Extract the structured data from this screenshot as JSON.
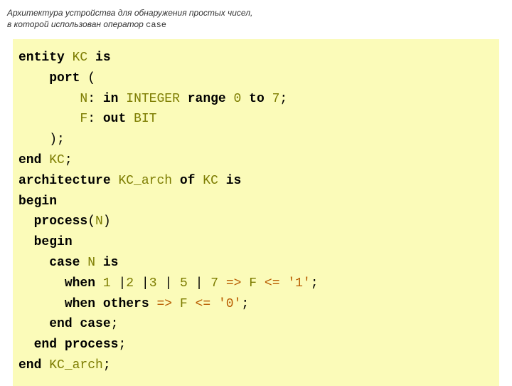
{
  "caption": {
    "line1": "Архитектура устройства для обнаружения простых чисел,",
    "line2_prefix": "в которой использован оператор ",
    "line2_mono": "case"
  },
  "code": {
    "entity_kw": "entity",
    "entity_name": "KC",
    "is_kw": "is",
    "port_kw": "port",
    "open_paren": "(",
    "n_id": "N",
    "colon": ":",
    "in_kw": "in",
    "integer_ty": "INTEGER",
    "range_kw": "range",
    "zero": "0",
    "to_kw": "to",
    "seven": "7",
    "semi": ";",
    "f_id": "F",
    "out_kw": "out",
    "bit_ty": "BIT",
    "close_paren": ")",
    "end_kw": "end",
    "arch_kw": "architecture",
    "arch_name": "KC_arch",
    "of_kw": "of",
    "begin_kw": "begin",
    "process_kw": "process",
    "case_kw": "case",
    "when_kw": "when",
    "others_kw": "others",
    "end_case": "end case",
    "end_process": "end process",
    "vals_1": "1",
    "vals_2": "2",
    "vals_3": "3",
    "vals_5": "5",
    "vals_7": "7",
    "pipe": "|",
    "arrow": "=>",
    "assign": "<=",
    "lit1": "'1'",
    "lit0": "'0'"
  }
}
